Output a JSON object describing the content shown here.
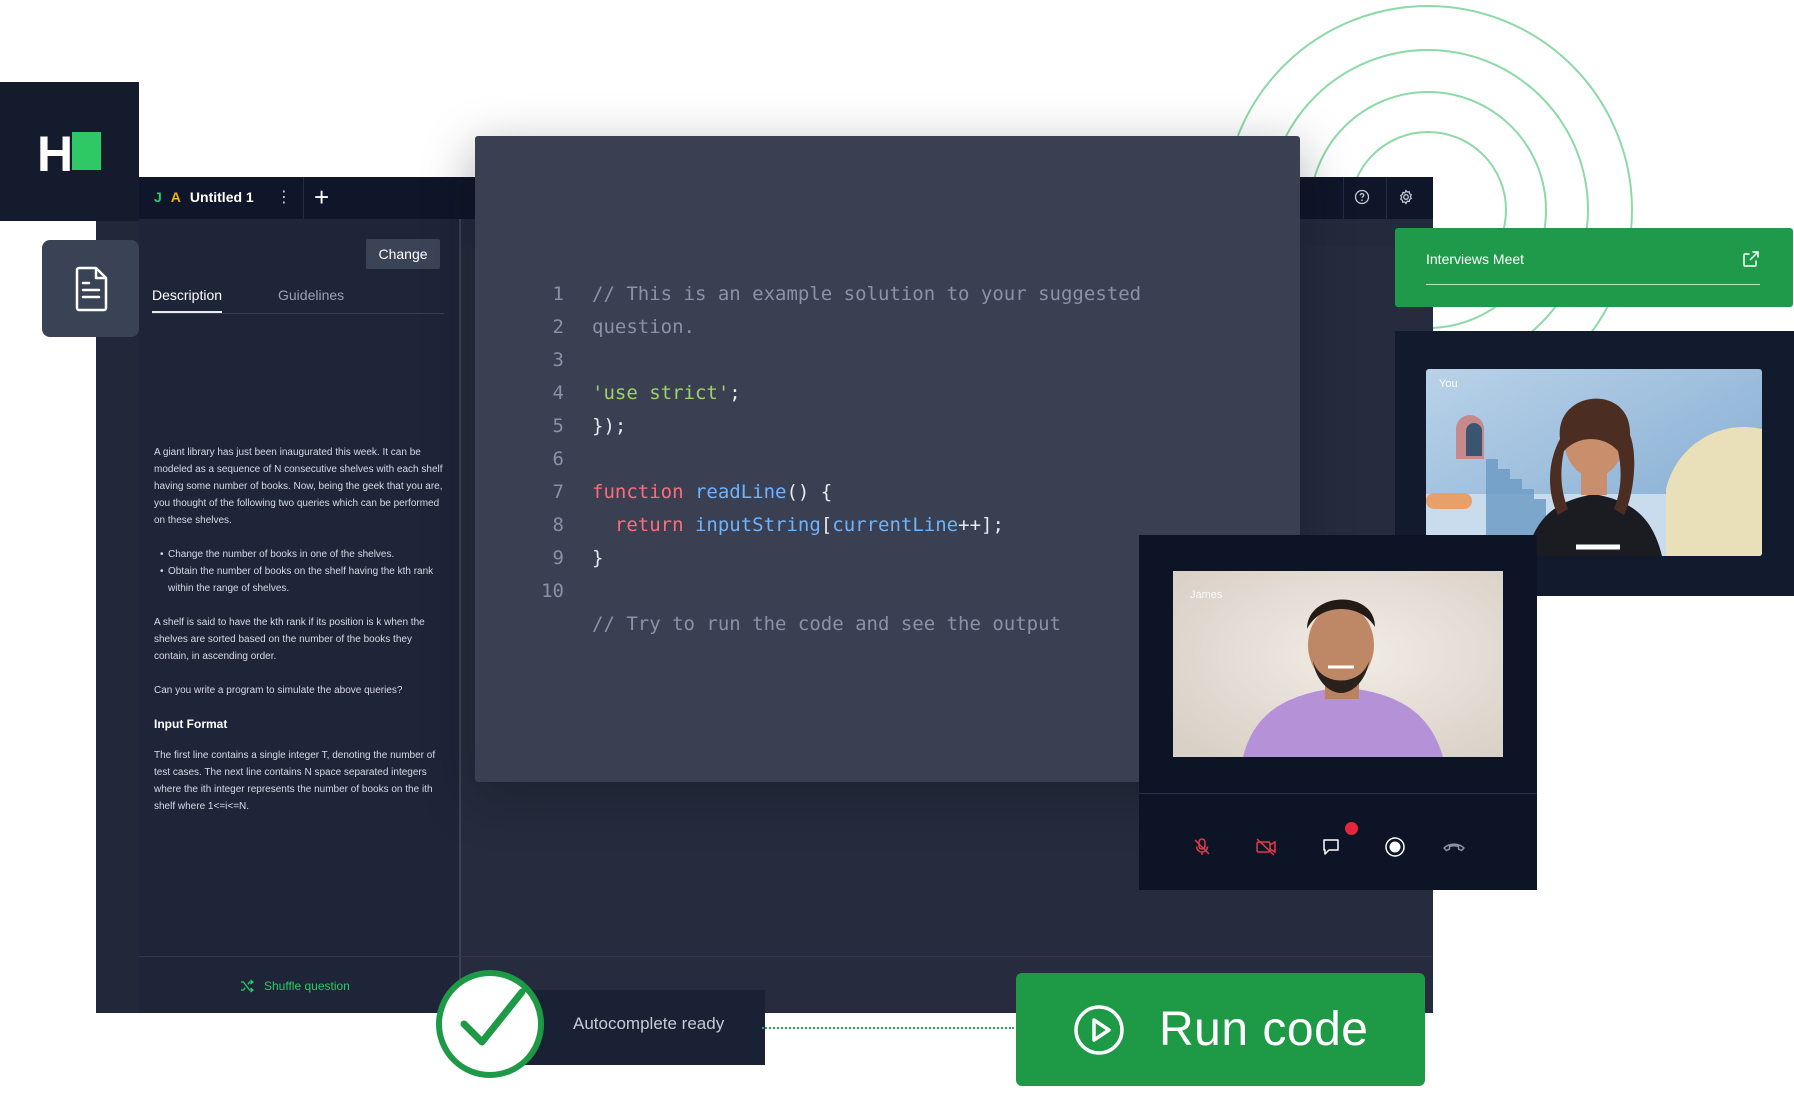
{
  "brand": {
    "logo_text": "H",
    "logo_accent": "#2ec866"
  },
  "editor": {
    "tab_lang_j": "J",
    "tab_lang_a": "A",
    "tab_title": "Untitled 1",
    "change_label": "Change",
    "tabs": [
      {
        "label": "Description"
      },
      {
        "label": "Guidelines"
      }
    ],
    "description": {
      "paragraph1": "A giant library has just been inaugurated this week. It can be modeled as a sequence of N consecutive shelves with each shelf having some number of books. Now, being the geek that you are, you thought of the following two queries which can be performed on these shelves.",
      "bullets": [
        "Change the number of books in one of the shelves.",
        "Obtain the number of books on the shelf having the kth rank within the range of shelves."
      ],
      "paragraph2": "A shelf is said to have the kth rank if its position is k when the shelves are sorted based on the number of the books they contain, in ascending order.",
      "paragraph3": "Can you write a program to simulate the above queries?",
      "input_format_title": "Input Format",
      "input_format_text": "The first line contains a single integer T, denoting the number of test cases. The next line contains N space separated integers where the ith integer represents the number of books on the ith shelf where 1<=i<=N."
    },
    "shuffle_label": "Shuffle question"
  },
  "code": {
    "lines": [
      {
        "n": "1",
        "comment": "// This is an example solution to your suggested"
      },
      {
        "n": "2",
        "comment": "question."
      },
      {
        "n": "3"
      },
      {
        "n": "4",
        "string": "'use strict'",
        "plain": ";"
      },
      {
        "n": "5",
        "plain": "});"
      },
      {
        "n": "6"
      },
      {
        "n": "7",
        "keyword": "function",
        "fn": "readLine",
        "plain": "() {"
      },
      {
        "n": "8",
        "keyword": "return",
        "fn": "inputString",
        "plain_a": "[",
        "fn2": "currentLine",
        "plain_b": "++];"
      },
      {
        "n": "9",
        "plain": "}"
      },
      {
        "n": "10"
      },
      {
        "n": "",
        "comment": "// Try to run the code and see the output"
      }
    ]
  },
  "meet": {
    "title": "Interviews Meet"
  },
  "videos": {
    "you_label": "You",
    "james_label": "James"
  },
  "status": {
    "autocomplete": "Autocomplete ready"
  },
  "run": {
    "label": "Run code"
  },
  "colors": {
    "green": "#1e9a47",
    "dark": "#131b2c",
    "ring": "#7fd49d",
    "alert_dot": "#e5263b"
  }
}
